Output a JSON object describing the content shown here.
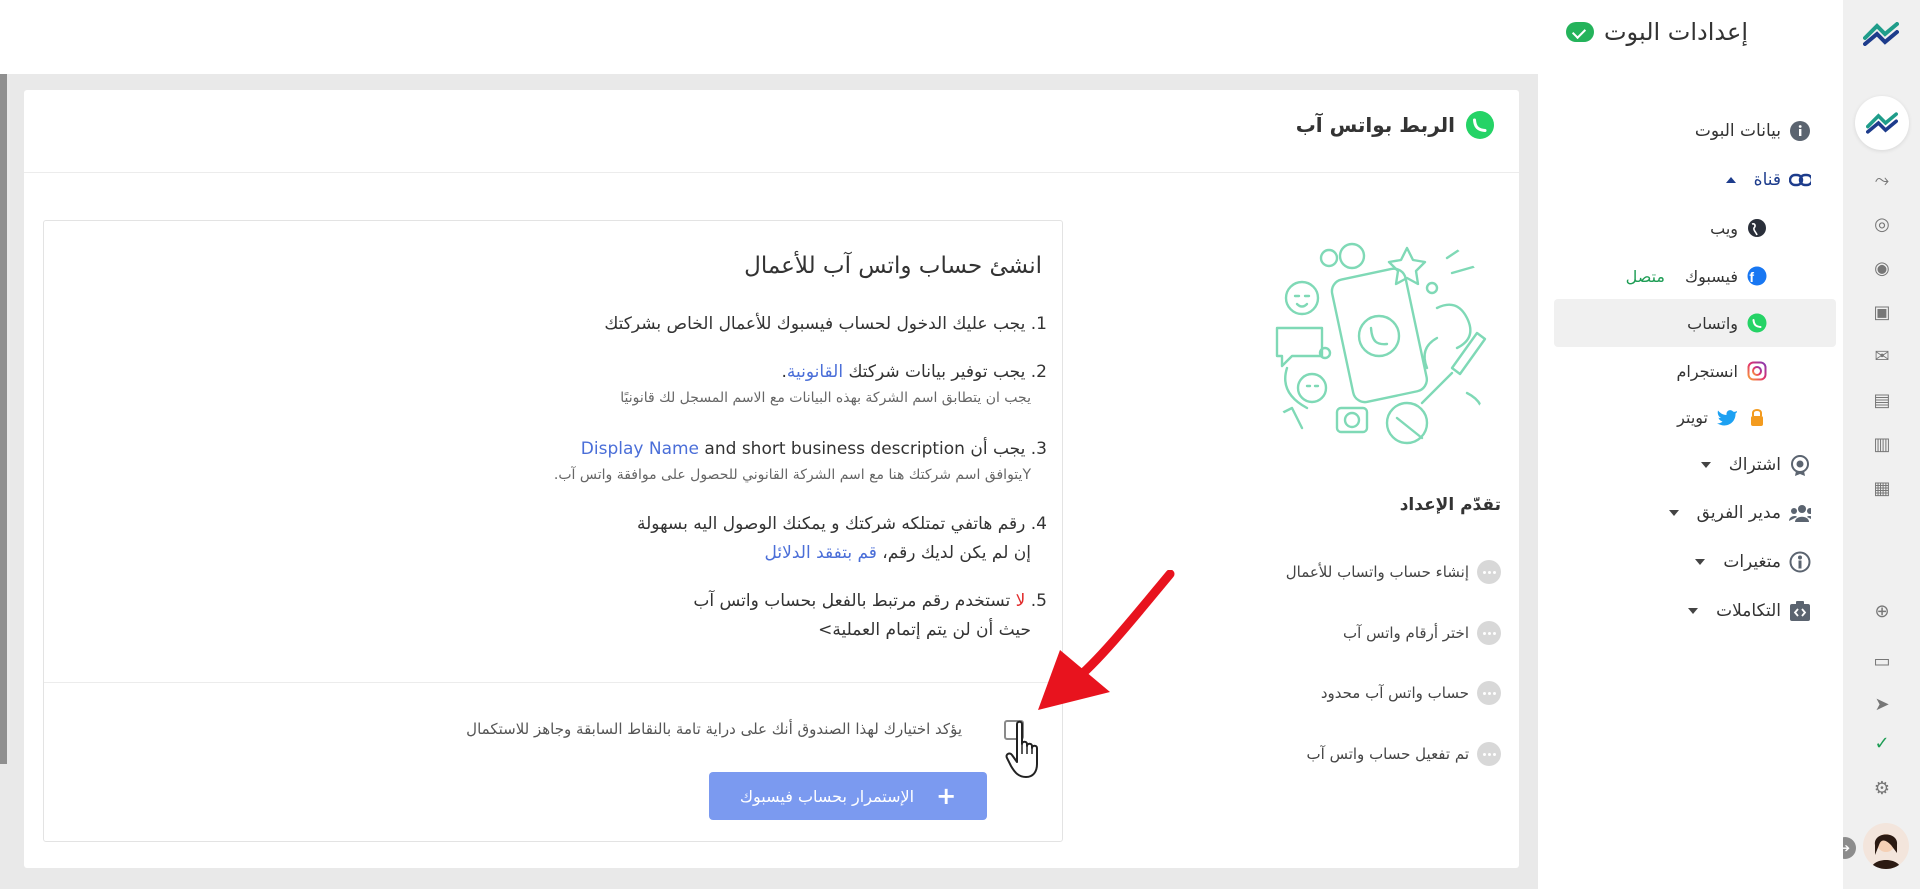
{
  "header": {
    "title": "إعدادات البوت"
  },
  "sidebar": {
    "items": [
      {
        "label": "بيانات البوت",
        "icon": "info-icon"
      },
      {
        "label": "قناة",
        "icon": "link-icon",
        "expanded": true
      },
      {
        "label": "ويب",
        "icon": "globe-icon"
      },
      {
        "label": "فيسبوك",
        "icon": "facebook-icon",
        "status": "متصل"
      },
      {
        "label": "واتساب",
        "icon": "whatsapp-icon",
        "active": true
      },
      {
        "label": "انستجرام",
        "icon": "instagram-icon"
      },
      {
        "label": "تويتر",
        "icon": "twitter-icon",
        "locked": true
      },
      {
        "label": "اشتراك",
        "icon": "badge-icon"
      },
      {
        "label": "مدير الفريق",
        "icon": "team-icon"
      },
      {
        "label": "متغيرات",
        "icon": "variable-icon"
      },
      {
        "label": "التكاملات",
        "icon": "integrations-icon"
      }
    ]
  },
  "card": {
    "title": "الربط بواتس آب",
    "progress_title": "تقدّم الإعداد",
    "steps": [
      "إنشاء حساب واتساب للأعمال",
      "اختر أرقام واتس آب",
      "حساب واتس آب محدود",
      "تم تفعيل حساب واتس آب"
    ],
    "box_title": "انشئ حساب واتس آب للأعمال",
    "items": {
      "i1": "1. يجب عليك الدخول لحساب فيسبوك للأعمال الخاص بشركتك",
      "i2_pre": "2. يجب توفير بيانات شركتك ",
      "i2_link": "القانونية",
      "i2_post": ".",
      "i2_note": "يجب ان يتطابق اسم الشركة بهذه البيانات مع الاسم المسجل لك قانونيًا",
      "i3_pre": "3. يجب أن ",
      "i3_link": "Display Name",
      "i3_post": " and short business description",
      "i3_note": "Yيتوافق اسم شركتك هنا مع اسم الشركة القانوني للحصول على موافقة واتس آب.",
      "i4": "4. رقم هاتفي تمتلكه شركتك و يمكنك الوصول اليه بسهولة",
      "i4_cont_pre": "إن لم يكن لديك رقم، ",
      "i4_cont_link": "قم بتفقد الدلائل",
      "i5_pre": "5. ",
      "i5_red": "لا",
      "i5_post": " تستخدم رقم مرتبط بالفعل بحساب واتس آب",
      "i5_cont": "حيث أن لن يتم إتمام العملية>"
    },
    "confirm_text": "يؤكد اختيارك لهذا الصندوق أنك على دراية تامة بالنقاط السابقة وجاهز للاستكمال",
    "continue_label": "الإستمرار بحساب فيسبوك"
  },
  "colors": {
    "accent": "#7b9af0",
    "link": "#4a6ed8",
    "whatsapp": "#25d366",
    "connected": "#1e9d55",
    "arrow": "#e8131e"
  }
}
